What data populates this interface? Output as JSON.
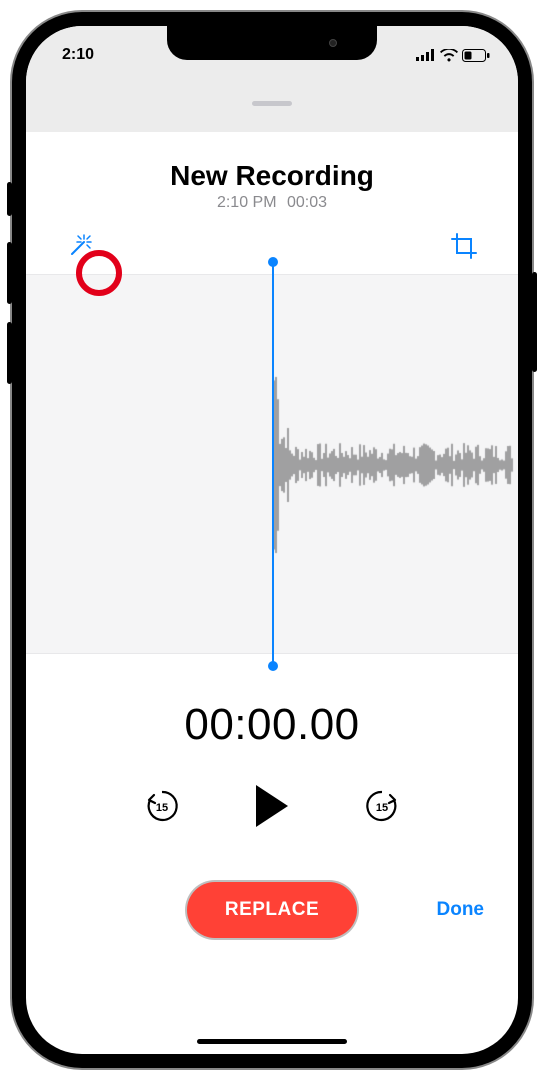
{
  "status": {
    "time": "2:10"
  },
  "recording": {
    "title": "New Recording",
    "time": "2:10 PM",
    "duration": "00:03"
  },
  "playback": {
    "timer": "00:00.00",
    "skip_seconds": "15"
  },
  "actions": {
    "replace_label": "REPLACE",
    "done_label": "Done"
  },
  "tools": {
    "enhance_name": "enhance-recording",
    "trim_name": "trim-recording"
  },
  "waveform": {
    "bar_count": 120,
    "seed": 7
  }
}
